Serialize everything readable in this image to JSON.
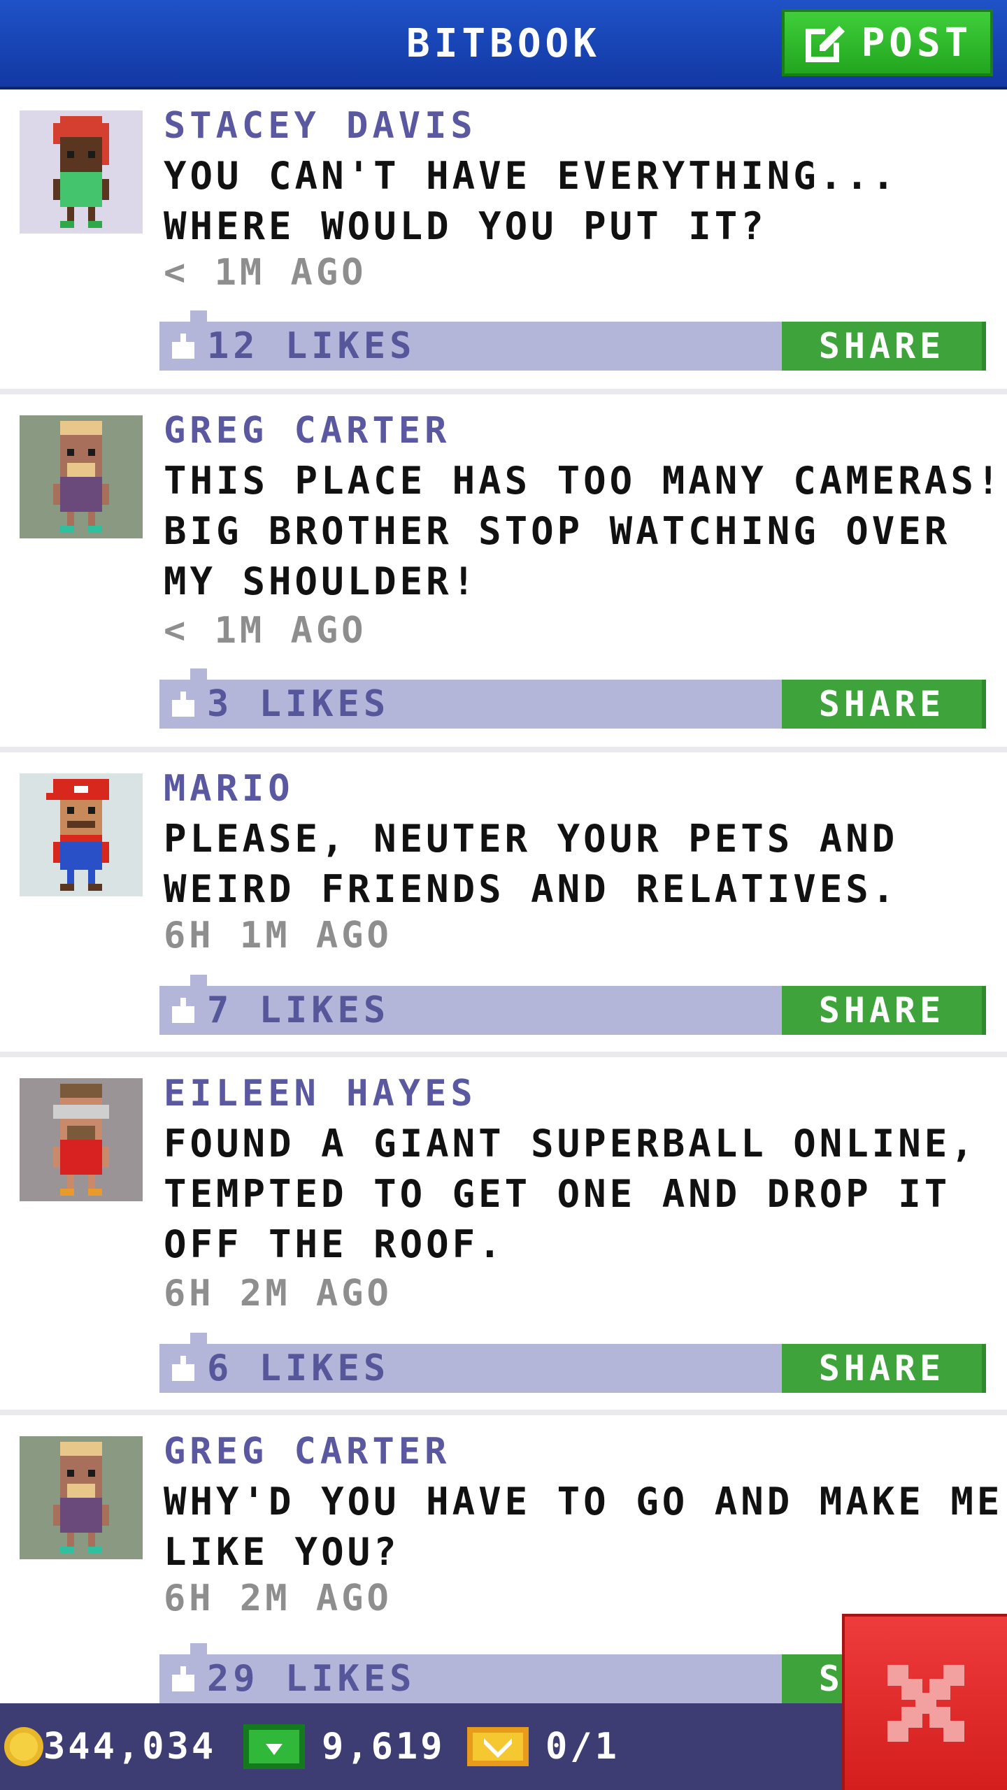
{
  "header": {
    "title": "BITBOOK",
    "post_label": "POST"
  },
  "posts": [
    {
      "author": "STACEY DAVIS",
      "message": "YOU CAN'T HAVE EVERYTHING... WHERE WOULD YOU PUT IT?",
      "time": "< 1M AGO",
      "likes": "12 LIKES",
      "share_label": "SHARE"
    },
    {
      "author": "GREG CARTER",
      "message": "THIS PLACE HAS TOO MANY CAMERAS! BIG BROTHER STOP WATCHING OVER MY SHOULDER!",
      "time": "< 1M AGO",
      "likes": "3 LIKES",
      "share_label": "SHARE"
    },
    {
      "author": "MARIO",
      "message": "PLEASE, NEUTER YOUR PETS AND WEIRD FRIENDS AND RELATIVES.",
      "time": "6H 1M AGO",
      "likes": "7 LIKES",
      "share_label": "SHARE"
    },
    {
      "author": "EILEEN HAYES",
      "message": "FOUND A GIANT SUPERBALL ONLINE, TEMPTED TO GET ONE AND DROP IT OFF THE ROOF.",
      "time": "6H 2M AGO",
      "likes": "6 LIKES",
      "share_label": "SHARE"
    },
    {
      "author": "GREG CARTER",
      "message": "WHY'D YOU HAVE TO GO AND MAKE ME LIKE YOU?",
      "time": "6H 2M AGO",
      "likes": "29 LIKES",
      "share_label": "SHARE"
    }
  ],
  "status": {
    "coins": "344,034",
    "bux": "9,619",
    "vip": "0/1"
  },
  "colors": {
    "header_blue": "#1f52c7",
    "post_green": "#22a51f",
    "likes_bar": "#b3b5d9",
    "author_text": "#5a58a0",
    "share_green": "#3da33a",
    "status_bar": "#3d3d73",
    "close_red": "#d41e1e"
  },
  "icons": {
    "post": "edit-icon",
    "like": "thumbs-up-icon",
    "coin": "coin-icon",
    "bux": "bux-icon",
    "vip": "vip-ticket-icon",
    "close": "close-icon"
  }
}
